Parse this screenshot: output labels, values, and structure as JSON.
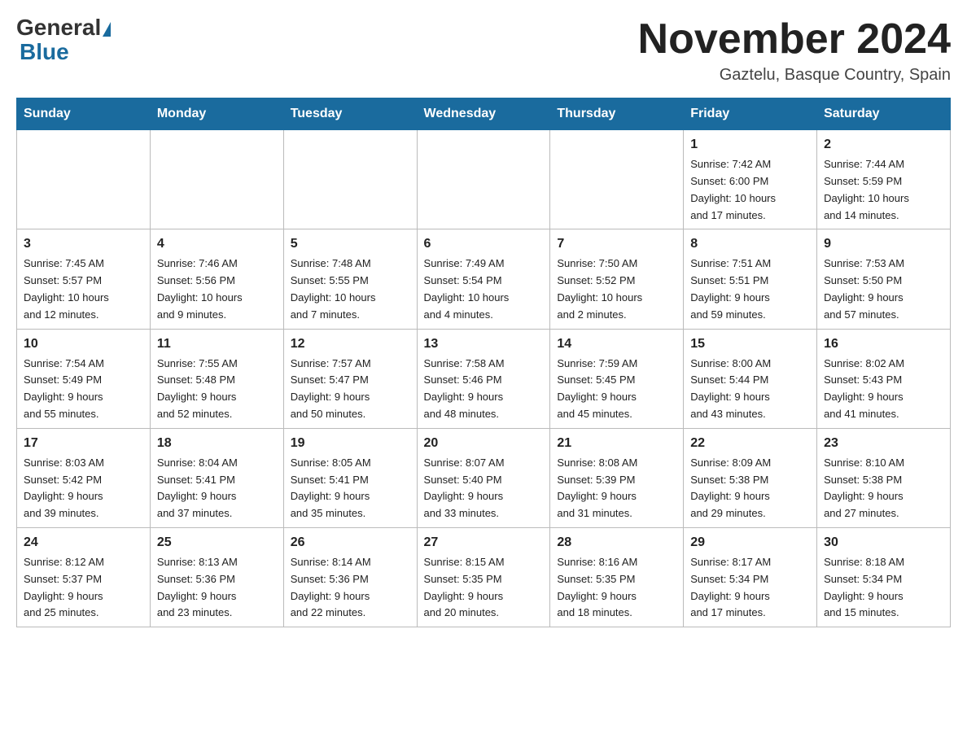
{
  "header": {
    "logo_general": "General",
    "logo_blue": "Blue",
    "title": "November 2024",
    "subtitle": "Gaztelu, Basque Country, Spain"
  },
  "days_of_week": [
    "Sunday",
    "Monday",
    "Tuesday",
    "Wednesday",
    "Thursday",
    "Friday",
    "Saturday"
  ],
  "weeks": [
    [
      {
        "day": "",
        "info": ""
      },
      {
        "day": "",
        "info": ""
      },
      {
        "day": "",
        "info": ""
      },
      {
        "day": "",
        "info": ""
      },
      {
        "day": "",
        "info": ""
      },
      {
        "day": "1",
        "info": "Sunrise: 7:42 AM\nSunset: 6:00 PM\nDaylight: 10 hours\nand 17 minutes."
      },
      {
        "day": "2",
        "info": "Sunrise: 7:44 AM\nSunset: 5:59 PM\nDaylight: 10 hours\nand 14 minutes."
      }
    ],
    [
      {
        "day": "3",
        "info": "Sunrise: 7:45 AM\nSunset: 5:57 PM\nDaylight: 10 hours\nand 12 minutes."
      },
      {
        "day": "4",
        "info": "Sunrise: 7:46 AM\nSunset: 5:56 PM\nDaylight: 10 hours\nand 9 minutes."
      },
      {
        "day": "5",
        "info": "Sunrise: 7:48 AM\nSunset: 5:55 PM\nDaylight: 10 hours\nand 7 minutes."
      },
      {
        "day": "6",
        "info": "Sunrise: 7:49 AM\nSunset: 5:54 PM\nDaylight: 10 hours\nand 4 minutes."
      },
      {
        "day": "7",
        "info": "Sunrise: 7:50 AM\nSunset: 5:52 PM\nDaylight: 10 hours\nand 2 minutes."
      },
      {
        "day": "8",
        "info": "Sunrise: 7:51 AM\nSunset: 5:51 PM\nDaylight: 9 hours\nand 59 minutes."
      },
      {
        "day": "9",
        "info": "Sunrise: 7:53 AM\nSunset: 5:50 PM\nDaylight: 9 hours\nand 57 minutes."
      }
    ],
    [
      {
        "day": "10",
        "info": "Sunrise: 7:54 AM\nSunset: 5:49 PM\nDaylight: 9 hours\nand 55 minutes."
      },
      {
        "day": "11",
        "info": "Sunrise: 7:55 AM\nSunset: 5:48 PM\nDaylight: 9 hours\nand 52 minutes."
      },
      {
        "day": "12",
        "info": "Sunrise: 7:57 AM\nSunset: 5:47 PM\nDaylight: 9 hours\nand 50 minutes."
      },
      {
        "day": "13",
        "info": "Sunrise: 7:58 AM\nSunset: 5:46 PM\nDaylight: 9 hours\nand 48 minutes."
      },
      {
        "day": "14",
        "info": "Sunrise: 7:59 AM\nSunset: 5:45 PM\nDaylight: 9 hours\nand 45 minutes."
      },
      {
        "day": "15",
        "info": "Sunrise: 8:00 AM\nSunset: 5:44 PM\nDaylight: 9 hours\nand 43 minutes."
      },
      {
        "day": "16",
        "info": "Sunrise: 8:02 AM\nSunset: 5:43 PM\nDaylight: 9 hours\nand 41 minutes."
      }
    ],
    [
      {
        "day": "17",
        "info": "Sunrise: 8:03 AM\nSunset: 5:42 PM\nDaylight: 9 hours\nand 39 minutes."
      },
      {
        "day": "18",
        "info": "Sunrise: 8:04 AM\nSunset: 5:41 PM\nDaylight: 9 hours\nand 37 minutes."
      },
      {
        "day": "19",
        "info": "Sunrise: 8:05 AM\nSunset: 5:41 PM\nDaylight: 9 hours\nand 35 minutes."
      },
      {
        "day": "20",
        "info": "Sunrise: 8:07 AM\nSunset: 5:40 PM\nDaylight: 9 hours\nand 33 minutes."
      },
      {
        "day": "21",
        "info": "Sunrise: 8:08 AM\nSunset: 5:39 PM\nDaylight: 9 hours\nand 31 minutes."
      },
      {
        "day": "22",
        "info": "Sunrise: 8:09 AM\nSunset: 5:38 PM\nDaylight: 9 hours\nand 29 minutes."
      },
      {
        "day": "23",
        "info": "Sunrise: 8:10 AM\nSunset: 5:38 PM\nDaylight: 9 hours\nand 27 minutes."
      }
    ],
    [
      {
        "day": "24",
        "info": "Sunrise: 8:12 AM\nSunset: 5:37 PM\nDaylight: 9 hours\nand 25 minutes."
      },
      {
        "day": "25",
        "info": "Sunrise: 8:13 AM\nSunset: 5:36 PM\nDaylight: 9 hours\nand 23 minutes."
      },
      {
        "day": "26",
        "info": "Sunrise: 8:14 AM\nSunset: 5:36 PM\nDaylight: 9 hours\nand 22 minutes."
      },
      {
        "day": "27",
        "info": "Sunrise: 8:15 AM\nSunset: 5:35 PM\nDaylight: 9 hours\nand 20 minutes."
      },
      {
        "day": "28",
        "info": "Sunrise: 8:16 AM\nSunset: 5:35 PM\nDaylight: 9 hours\nand 18 minutes."
      },
      {
        "day": "29",
        "info": "Sunrise: 8:17 AM\nSunset: 5:34 PM\nDaylight: 9 hours\nand 17 minutes."
      },
      {
        "day": "30",
        "info": "Sunrise: 8:18 AM\nSunset: 5:34 PM\nDaylight: 9 hours\nand 15 minutes."
      }
    ]
  ]
}
